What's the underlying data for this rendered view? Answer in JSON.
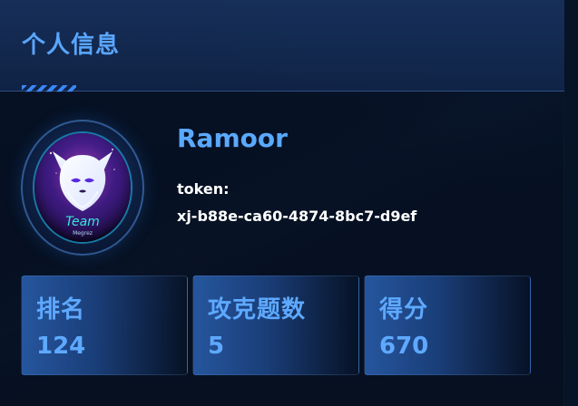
{
  "header": {
    "title": "个人信息"
  },
  "profile": {
    "name": "Ramoor",
    "token_label": "token:",
    "token_value": "xj-b88e-ca60-4874-8bc7-d9ef",
    "avatar_text": {
      "team": "Team",
      "sub": "Megrez"
    }
  },
  "stats": [
    {
      "label": "排名",
      "value": "124"
    },
    {
      "label": "攻克题数",
      "value": "5"
    },
    {
      "label": "得分",
      "value": "670"
    }
  ],
  "theme": {
    "accent": "#5aa9ff",
    "background": "#071326",
    "card": "#2a5aa5"
  },
  "icons": {
    "header_decoration": "striped-accent",
    "avatar": "fox-avatar"
  }
}
